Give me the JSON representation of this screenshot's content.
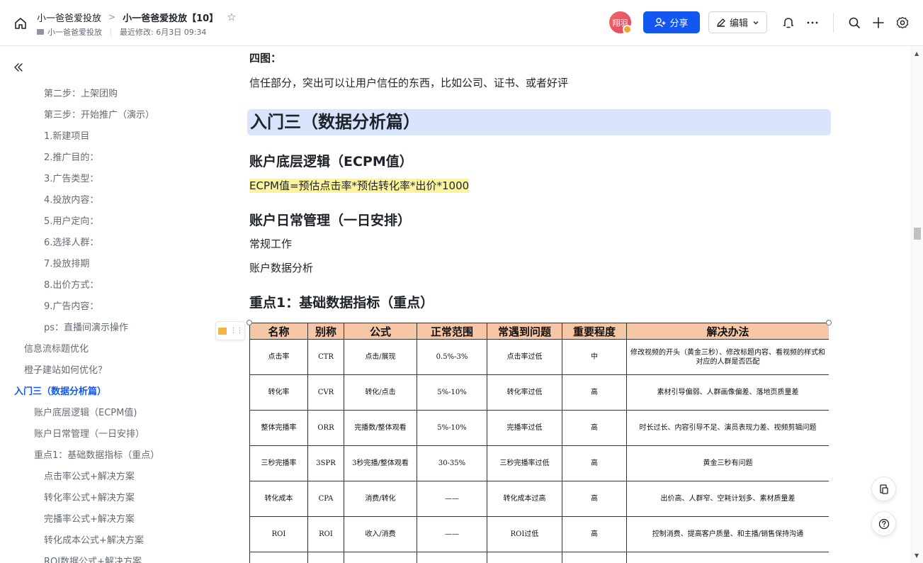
{
  "header": {
    "breadcrumb_parent": "小一爸爸爱投放",
    "breadcrumb_sep": ">",
    "title": "小一爸爸爱投放【10】",
    "folder": "小一爸爸爱投放",
    "last_modified": "最近修改: 6月3日 09:34",
    "avatar_text": "翔羽",
    "share_label": "分享",
    "edit_label": "编辑"
  },
  "sidebar": {
    "items": [
      {
        "label": "第二步：上架团购",
        "level": 4
      },
      {
        "label": "第三步：开始推广（演示）",
        "level": 4
      },
      {
        "label": "1.新建项目",
        "level": 4
      },
      {
        "label": "2.推广目的：",
        "level": 4
      },
      {
        "label": "3.广告类型：",
        "level": 4
      },
      {
        "label": "4.投放内容：",
        "level": 4
      },
      {
        "label": "5.用户定向：",
        "level": 4
      },
      {
        "label": "6.选择人群：",
        "level": 4
      },
      {
        "label": "7.投放排期",
        "level": 4
      },
      {
        "label": "8.出价方式：",
        "level": 4
      },
      {
        "label": "9.广告内容：",
        "level": 4
      },
      {
        "label": "ps：直播间演示操作",
        "level": 4
      },
      {
        "label": "信息流标题优化",
        "level": 2
      },
      {
        "label": "橙子建站如何优化？",
        "level": 2
      },
      {
        "label": "入门三（数据分析篇）",
        "level": 1,
        "active": true
      },
      {
        "label": "账户底层逻辑（ECPM值)",
        "level": 3
      },
      {
        "label": "账户日常管理（一日安排）",
        "level": 3
      },
      {
        "label": "重点1：基础数据指标（重点）",
        "level": 3
      },
      {
        "label": "点击率公式+解决方案",
        "level": 4
      },
      {
        "label": "转化率公式+解决方案",
        "level": 4
      },
      {
        "label": "完播率公式+解决方案",
        "level": 4
      },
      {
        "label": "转化成本公式+解决方案",
        "level": 4
      },
      {
        "label": "ROI数据公式+解决方案",
        "level": 4
      }
    ]
  },
  "doc": {
    "h_four_pics": "四图：",
    "trust_text": "信任部分，突出可以让用户信任的东西，比如公司、证书、或者好评",
    "h1_section": "入门三（数据分析篇）",
    "h_ecpm": "账户底层逻辑（ECPM值）",
    "ecpm_formula": "ECPM值=预估点击率*预估转化率*出价*1000",
    "h_daily": "账户日常管理（一日安排）",
    "routine_work": "常规工作",
    "account_analysis": "账户数据分析",
    "h_key1": "重点1：基础数据指标（重点）"
  },
  "table": {
    "headers": [
      "名称",
      "别称",
      "公式",
      "正常范围",
      "常遇到问题",
      "重要程度",
      "解决办法"
    ],
    "rows": [
      [
        "点击率",
        "CTR",
        "点击/展现",
        "0.5%-3%",
        "点击率过低",
        "中",
        "修改视频的开头（黄金三秒）、修改标题内容、看视频的样式和对应的人群是否匹配"
      ],
      [
        "转化率",
        "CVR",
        "转化/点击",
        "5%-10%",
        "转化率过低",
        "高",
        "素材引导偏弱、人群画像偏差、落地页质量差"
      ],
      [
        "整体完播率",
        "ORR",
        "完播数/整体观看",
        "5%-10%",
        "完播率过低",
        "高",
        "时长过长、内容引导不足、演员表现力差、视频剪辑问题"
      ],
      [
        "三秒完播率",
        "3SPR",
        "3秒完播/整体观看",
        "30-35%",
        "三秒完播率过低",
        "高",
        "黄金三秒有问题"
      ],
      [
        "转化成本",
        "CPA",
        "消费/转化",
        "——",
        "转化成本过高",
        "高",
        "出价高、人群窄、空耗计划多、素材质量差"
      ],
      [
        "ROI",
        "ROI",
        "收入/消费",
        "——",
        "ROI过低",
        "高",
        "控制消费、提高客户质量、和主播/销售保持沟通"
      ]
    ]
  }
}
